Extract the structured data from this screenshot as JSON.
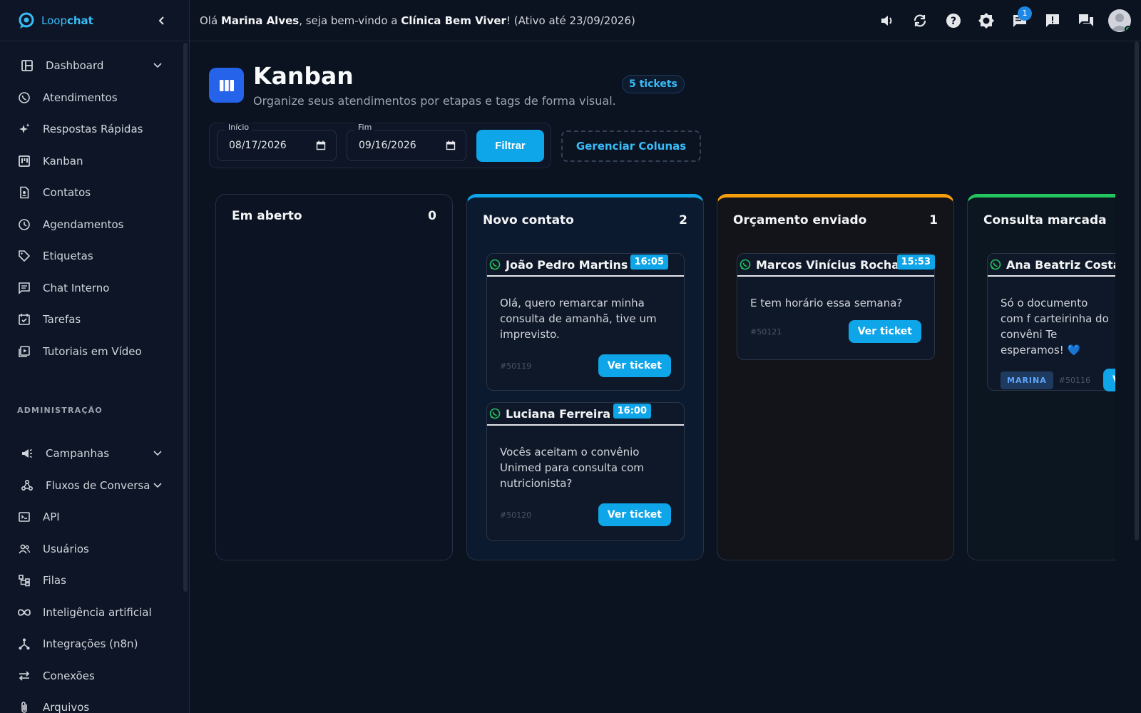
{
  "app": {
    "logo_loop": "Loop",
    "logo_chat": "chat"
  },
  "greeting": {
    "hello": "Olá",
    "user": "Marina Alves",
    "mid": ", seja bem-vindo a",
    "clinic": "Clínica Bem Viver",
    "tail": "! (Ativo até 23/09/2026)"
  },
  "topbar": {
    "notifications_count": "1"
  },
  "sidebar": {
    "items": [
      {
        "label": "Dashboard",
        "icon": "dashboard-icon"
      },
      {
        "label": "Atendimentos",
        "icon": "whatsapp-icon"
      },
      {
        "label": "Respostas Rápidas",
        "icon": "sparkles-icon"
      },
      {
        "label": "Kanban",
        "icon": "kanban-icon"
      },
      {
        "label": "Contatos",
        "icon": "contacts-icon"
      },
      {
        "label": "Agendamentos",
        "icon": "clock-icon"
      },
      {
        "label": "Etiquetas",
        "icon": "tag-icon"
      },
      {
        "label": "Chat Interno",
        "icon": "chat-icon"
      },
      {
        "label": "Tarefas",
        "icon": "tasks-icon"
      },
      {
        "label": "Tutoriais em Vídeo",
        "icon": "video-icon"
      }
    ],
    "admin_title": "ADMINISTRAÇÃO",
    "admin_items": [
      {
        "label": "Campanhas",
        "icon": "megaphone-icon"
      },
      {
        "label": "Fluxos de Conversa",
        "icon": "flow-icon"
      },
      {
        "label": "API",
        "icon": "terminal-icon"
      },
      {
        "label": "Usuários",
        "icon": "users-icon"
      },
      {
        "label": "Filas",
        "icon": "queue-icon"
      },
      {
        "label": "Inteligência artificial",
        "icon": "infinity-icon"
      },
      {
        "label": "Integrações (n8n)",
        "icon": "integration-icon"
      },
      {
        "label": "Conexões",
        "icon": "connections-icon"
      },
      {
        "label": "Arquivos",
        "icon": "paperclip-icon"
      }
    ]
  },
  "page": {
    "title": "Kanban",
    "subtitle": "Organize seus atendimentos por etapas e tags de forma visual.",
    "ticket_count": "5 tickets"
  },
  "filters": {
    "start_label": "Início",
    "start_value": "08/17/2026",
    "end_label": "Fim",
    "end_value": "09/16/2026",
    "filter_button": "Filtrar",
    "manage_columns": "Gerenciar Colunas"
  },
  "colors": {
    "accent": "#0ea5e9",
    "novo_contato": "#0ea5e9",
    "orcamento": "#f59e0b",
    "consulta": "#22c55e"
  },
  "columns": [
    {
      "title": "Em aberto",
      "count": "0",
      "cards": []
    },
    {
      "title": "Novo contato",
      "count": "2",
      "cards": [
        {
          "name": "João Pedro Martins",
          "time": "16:05",
          "message": "Olá, quero remarcar minha consulta de amanhã, tive um imprevisto.",
          "id": "#50119",
          "button": "Ver ticket"
        },
        {
          "name": "Luciana Ferreira",
          "time": "16:00",
          "message": "Vocês aceitam o convênio Unimed para consulta com nutricionista?",
          "id": "#50120",
          "button": "Ver ticket"
        }
      ]
    },
    {
      "title": "Orçamento enviado",
      "count": "1",
      "cards": [
        {
          "name": "Marcos Vinícius Rocha",
          "time": "15:53",
          "message": "E tem horário essa semana?",
          "id": "#50121",
          "button": "Ver ticket"
        }
      ]
    },
    {
      "title": "Consulta marcada",
      "count": "",
      "cards": [
        {
          "name": "Ana Beatriz Costa",
          "time": "",
          "message": "Só o documento com f carteirinha do convêni Te esperamos! 💙",
          "tag": "MARINA",
          "id": "#50116",
          "button": "Ver ticket"
        }
      ]
    }
  ]
}
